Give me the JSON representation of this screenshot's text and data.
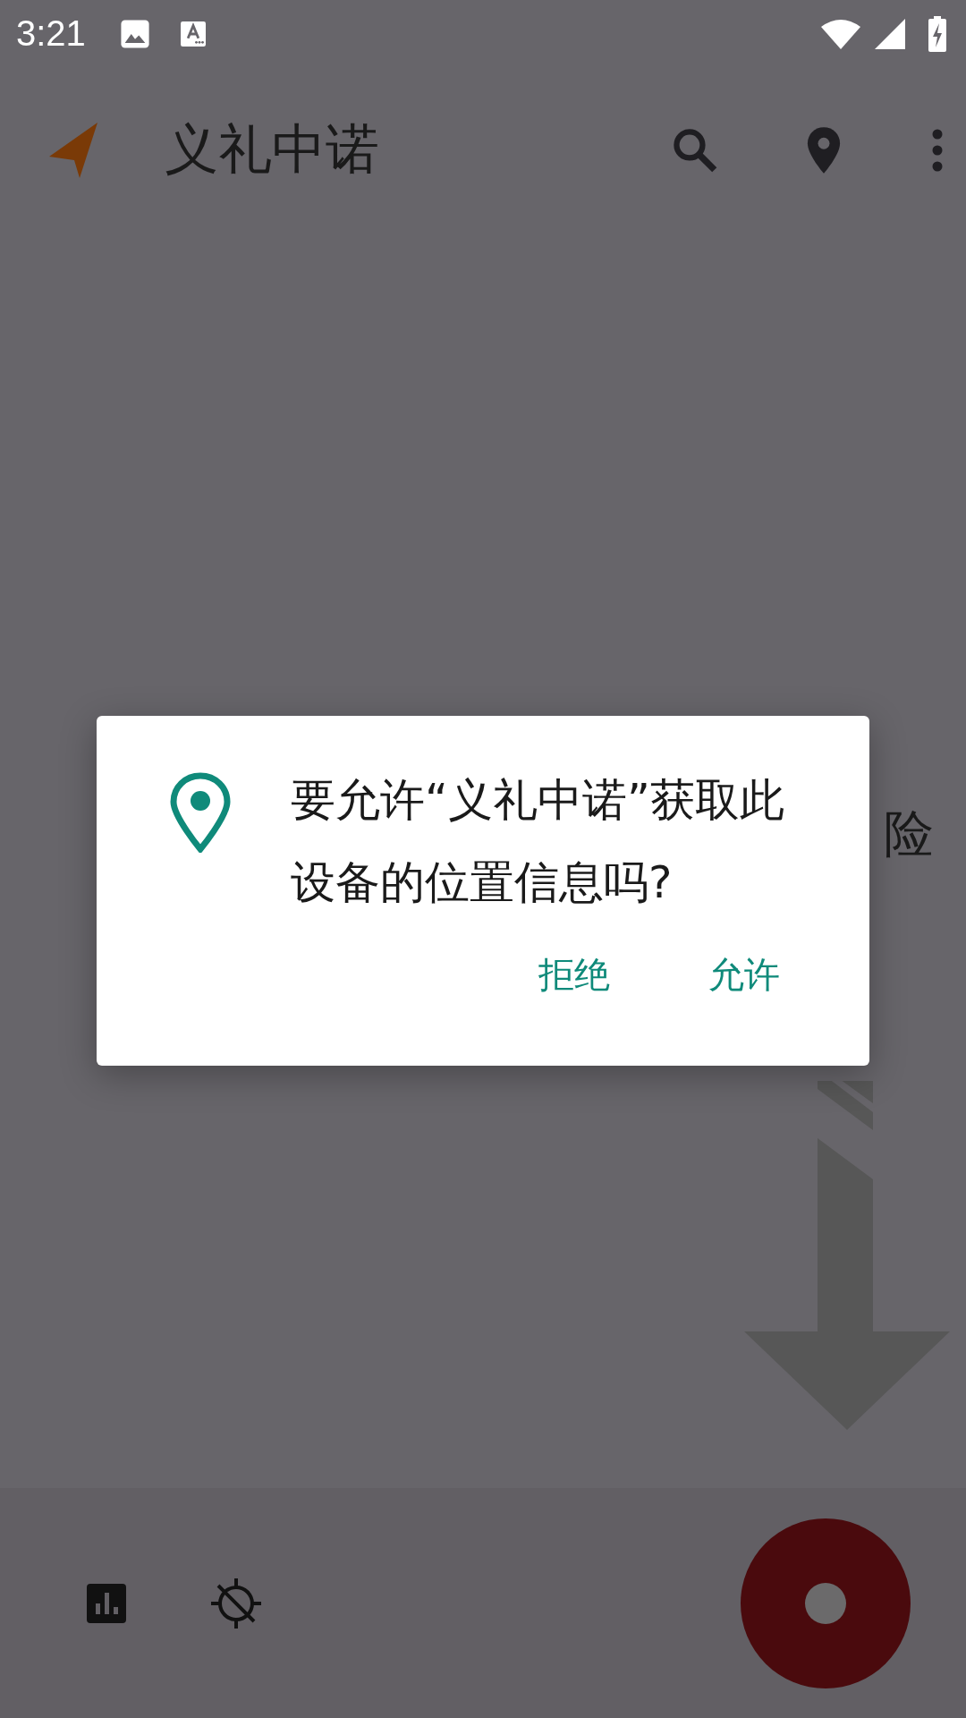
{
  "status_bar": {
    "time": "3:21"
  },
  "app_bar": {
    "title": "义礼中诺"
  },
  "background": {
    "partial_text": "险"
  },
  "dialog": {
    "message": "要允许“义礼中诺”获取此设备的位置信息吗?",
    "buttons": [
      "拒绝",
      "允许"
    ]
  }
}
